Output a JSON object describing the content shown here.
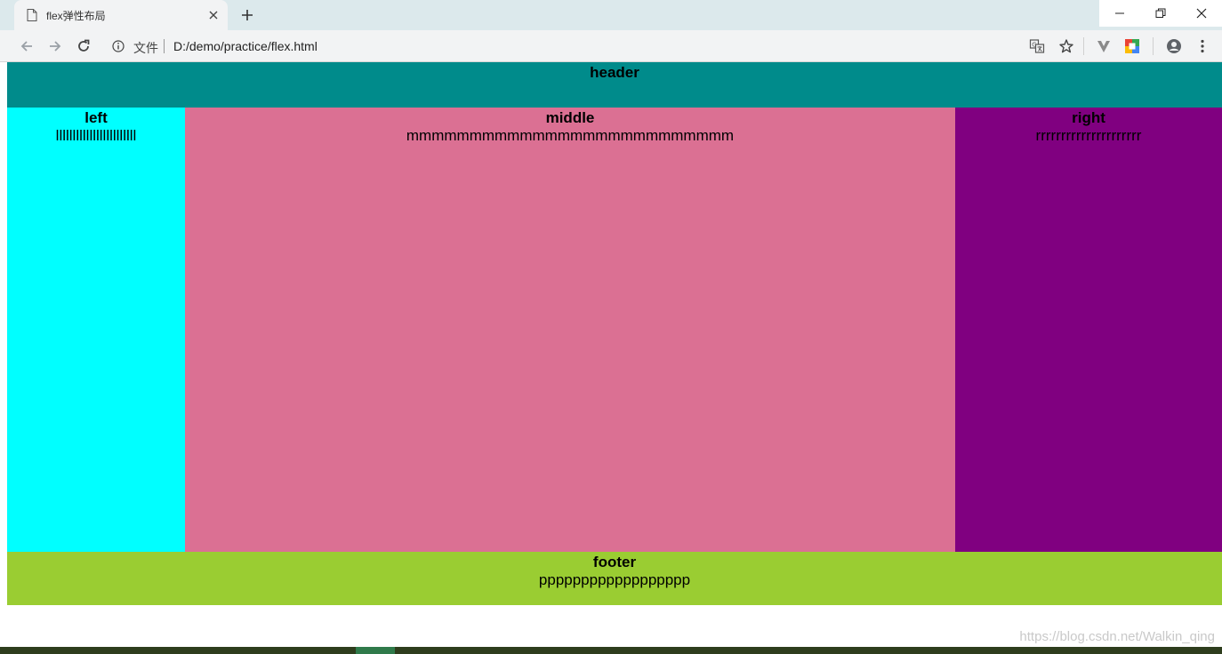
{
  "browser": {
    "tab": {
      "title": "flex弹性布局"
    },
    "address": {
      "scheme_label": "文件",
      "url": "D:/demo/practice/flex.html"
    },
    "icons": [
      "page-icon",
      "close-icon",
      "plus-icon",
      "minimize-icon",
      "restore-icon",
      "close-window-icon",
      "back-arrow-icon",
      "forward-arrow-icon",
      "reload-icon",
      "info-icon",
      "translate-icon",
      "star-icon",
      "vivaldi-extension-icon",
      "extension-icon",
      "profile-icon",
      "menu-kebab-icon"
    ]
  },
  "page": {
    "header": {
      "title": "header"
    },
    "left": {
      "title": "left",
      "text": "llllllllllllllllllllllll"
    },
    "middle": {
      "title": "middle",
      "text": "mmmmmmmmmmmmmmmmmmmmmmmmmm"
    },
    "right": {
      "title": "right",
      "text": "rrrrrrrrrrrrrrrrrrrrr"
    },
    "footer": {
      "title": "footer",
      "text": "pppppppppppppppppp"
    },
    "colors": {
      "header": "#008b8b",
      "left": "#00ffff",
      "middle": "#db7093",
      "right": "#800080",
      "footer": "#9acd32"
    }
  },
  "watermark": "https://blog.csdn.net/Walkin_qing"
}
